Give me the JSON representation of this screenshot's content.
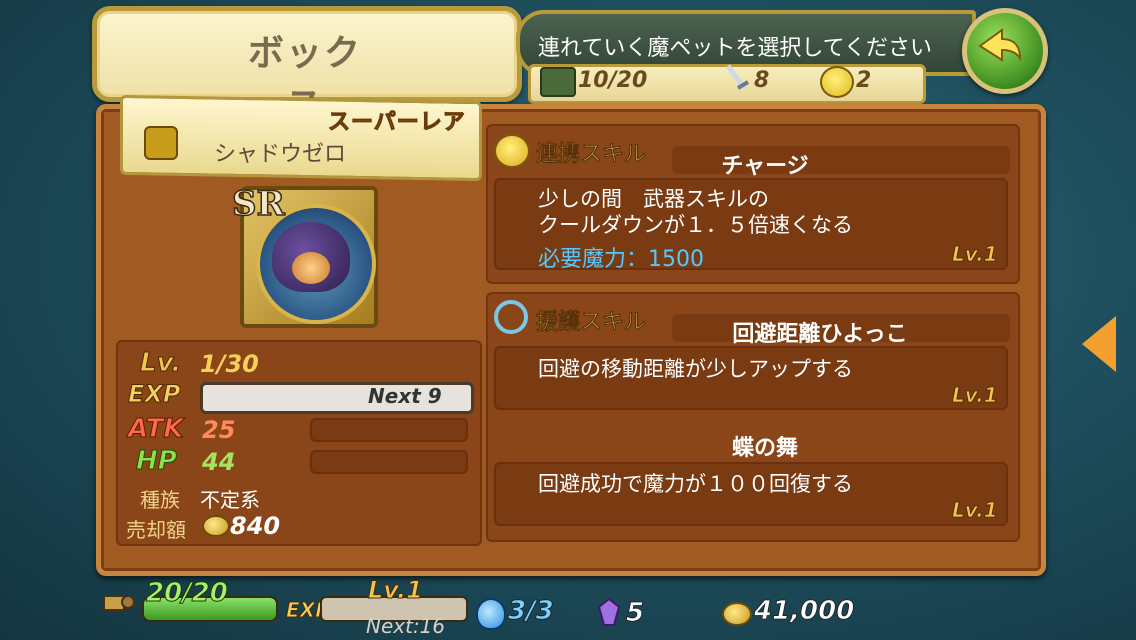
{
  "header": {
    "title": "ボックス",
    "instruction": "連れていく魔ペットを選択してください",
    "box_count": "10/20",
    "sword_count": "8",
    "chick_count": "2"
  },
  "pet": {
    "rarity_label": "スーパーレア",
    "name": "シャドウゼロ",
    "rarity_code": "SR",
    "level_label": "Lv.",
    "level": "1/30",
    "exp_label": "EXP",
    "next_exp": "Next 9",
    "atk_label": "ATK",
    "atk": "25",
    "hp_label": "HP",
    "hp": "44",
    "race_label": "種族",
    "race": "不定系",
    "sell_label": "売却額",
    "sell_price": "840"
  },
  "skills": {
    "link": {
      "header": "連携スキル",
      "name": "チャージ",
      "desc_line1": "少しの間　武器スキルの",
      "desc_line2": "クールダウンが１．５倍速くなる",
      "cost": "必要魔力：1500",
      "level": "Lv.1"
    },
    "support": {
      "header": "援護スキル",
      "skill1_name": "回避距離ひよっこ",
      "skill1_desc": "回避の移動距離が少しアップする",
      "skill1_level": "Lv.1",
      "skill2_name": "蝶の舞",
      "skill2_desc": "回避成功で魔力が１００回復する",
      "skill2_level": "Lv.1"
    }
  },
  "footer": {
    "stamina": "20/20",
    "exp_label": "EXP",
    "player_level": "Lv.1",
    "player_next": "Next:16",
    "potion": "3/3",
    "crystal": "5",
    "gold": "41,000"
  },
  "colors": {
    "panel": "#a05a22",
    "accent_gold": "#f0c64c",
    "cost_blue": "#55c8ff",
    "atk_red": "#ff6a4a",
    "hp_green": "#8fe04a"
  }
}
